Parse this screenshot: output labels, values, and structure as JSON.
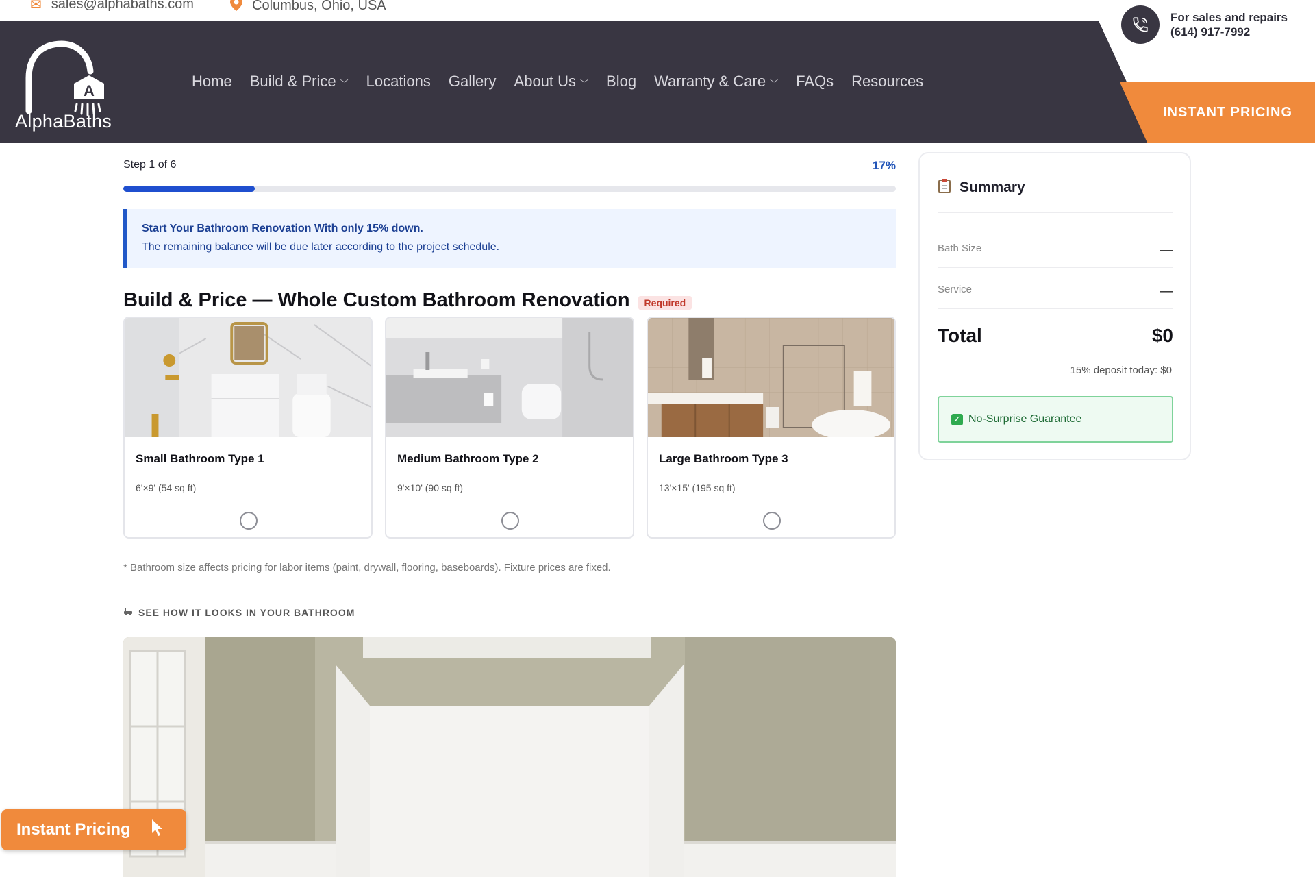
{
  "topbar": {
    "email": "sales@alphabaths.com",
    "location": "Columbus, Ohio, USA"
  },
  "header": {
    "logo_text": "AlphaBaths",
    "phone_label": "For sales and repairs",
    "phone_number": "(614) 917-7992",
    "cta_label": "INSTANT PRICING",
    "nav": [
      "Home",
      "Build & Price",
      "Locations",
      "Gallery",
      "About Us",
      "Blog",
      "Warranty & Care",
      "FAQs",
      "Resources"
    ]
  },
  "progress": {
    "step_label": "Step 1 of 6",
    "percent_label": "17%",
    "percent": 17
  },
  "notice": {
    "title": "Start Your Bathroom Renovation With only 15% down.",
    "body": "The remaining balance will be due later according to the project schedule."
  },
  "section": {
    "title": "Build & Price — Whole Custom Bathroom Renovation",
    "required_label": "Required"
  },
  "cards": [
    {
      "name": "Small Bathroom Type 1",
      "dims": "6'×9' (54 sq ft)"
    },
    {
      "name": "Medium Bathroom Type 2",
      "dims": "9'×10' (90 sq ft)"
    },
    {
      "name": "Large Bathroom Type 3",
      "dims": "13'×15' (195 sq ft)"
    }
  ],
  "footnote": "* Bathroom size affects pricing for labor items (paint, drywall, flooring, baseboards). Fixture prices are fixed.",
  "preview_label": "SEE HOW IT LOOKS IN YOUR BATHROOM",
  "summary": {
    "title": "Summary",
    "rows": [
      {
        "label": "Bath Size",
        "value": "—"
      },
      {
        "label": "Service",
        "value": "—"
      }
    ],
    "total_label": "Total",
    "total_value": "$0",
    "deposit": "15% deposit today: $0",
    "guarantee": "No-Surprise Guarantee"
  },
  "floating_button": "Instant Pricing",
  "colors": {
    "header_bg": "#393642",
    "accent_orange": "#f08a3c",
    "progress_blue": "#1f4fcf",
    "guarantee_green": "#2eaa4f"
  }
}
